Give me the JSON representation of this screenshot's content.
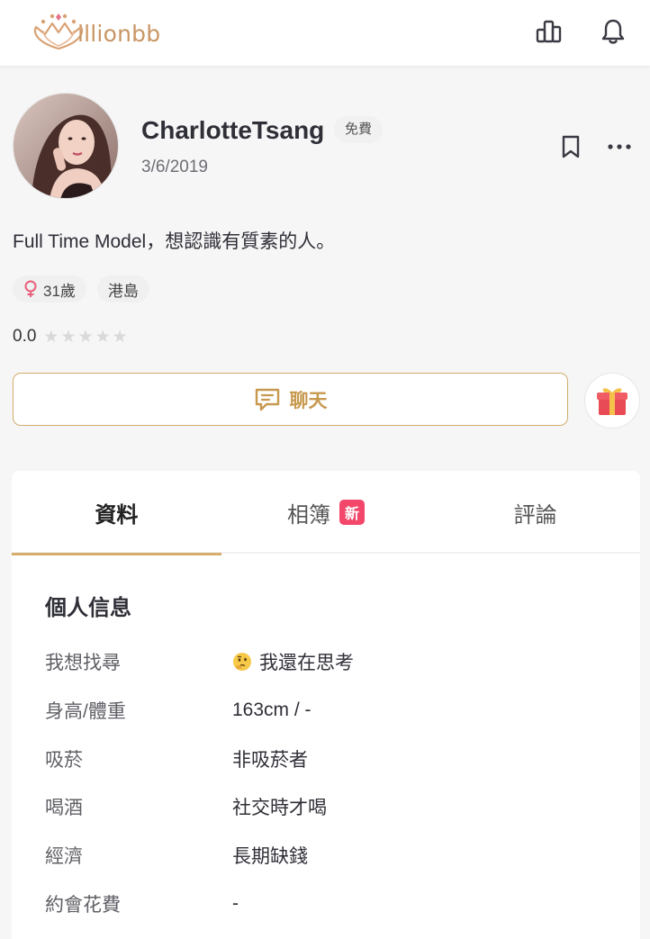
{
  "header": {
    "brand": "Millionbb",
    "brand_text": "illionbb",
    "icons": [
      "ranking-icon",
      "bell-icon"
    ]
  },
  "profile": {
    "name": "CharlotteTsang",
    "membership_badge": "免費",
    "date": "3/6/2019",
    "bio": "Full Time Model，想認識有質素的人。",
    "tags": [
      {
        "icon": "female-icon",
        "label": "31歲"
      },
      {
        "label": "港島"
      }
    ],
    "rating": "0.0",
    "stars_filled": 0,
    "stars_total": 5,
    "chat_label": "聊天"
  },
  "tabs": [
    {
      "label": "資料",
      "active": true
    },
    {
      "label": "相簿",
      "badge": "新"
    },
    {
      "label": "評論"
    }
  ],
  "personal_info": {
    "title": "個人信息",
    "rows": [
      {
        "label": "我想找尋",
        "value": "我還在思考",
        "icon": "thinking-face-emoji"
      },
      {
        "label": "身高/體重",
        "value": "163cm / -"
      },
      {
        "label": "吸菸",
        "value": "非吸菸者"
      },
      {
        "label": "喝酒",
        "value": "社交時才喝"
      },
      {
        "label": "經濟",
        "value": "長期缺錢"
      },
      {
        "label": "約會花費",
        "value": "-"
      }
    ]
  },
  "colors": {
    "accent_gold": "#d2ac6c",
    "chat_text": "#c7994f",
    "new_badge": "#f2476b",
    "female_icon": "#e8607a"
  }
}
